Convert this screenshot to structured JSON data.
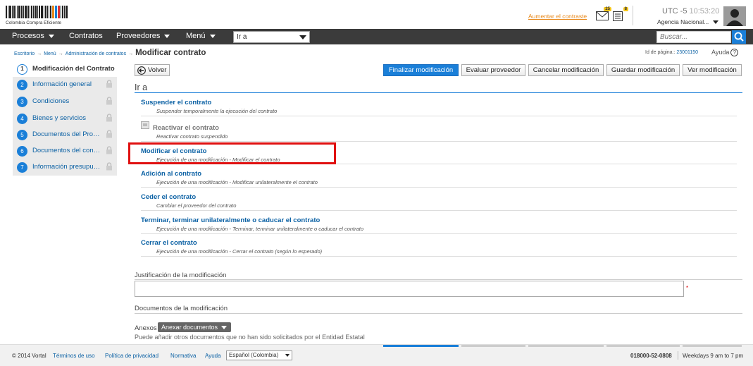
{
  "header": {
    "logo_text": "Colombia Compra Eficiente",
    "contrast_link": "Aumentar el contraste",
    "mail_badge": "25",
    "tasks_badge": "8",
    "utc_label": "UTC -5",
    "time": "10:53:20",
    "agency": "Agencia Nacional..."
  },
  "nav": {
    "items": [
      {
        "label": "Procesos",
        "dropdown": true
      },
      {
        "label": "Contratos",
        "dropdown": false
      },
      {
        "label": "Proveedores",
        "dropdown": true
      },
      {
        "label": "Menú",
        "dropdown": true
      }
    ],
    "goto_value": "Ir a",
    "search_placeholder": "Buscar..."
  },
  "breadcrumb": {
    "items": [
      "Escritorio",
      "Menú",
      "Administración de contratos"
    ],
    "current": "Modificar contrato",
    "page_id_label": "Id de página::",
    "page_id": "23001150",
    "help": "Ayuda",
    "help_symbol": "?"
  },
  "steps": [
    {
      "num": "1",
      "label": "Modificación del Contrato",
      "active": true
    },
    {
      "num": "2",
      "label": "Información general",
      "locked": true
    },
    {
      "num": "3",
      "label": "Condiciones",
      "locked": true
    },
    {
      "num": "4",
      "label": "Bienes y servicios",
      "locked": true
    },
    {
      "num": "5",
      "label": "Documentos del Proveedor",
      "locked": true
    },
    {
      "num": "6",
      "label": "Documentos del contrato",
      "locked": true
    },
    {
      "num": "7",
      "label": "Información presupuestal",
      "locked": true
    }
  ],
  "toolbar": {
    "back": "Volver",
    "finalize": "Finalizar modificación",
    "evaluate": "Evaluar proveedor",
    "cancel": "Cancelar modificación",
    "save": "Guardar modificación",
    "view": "Ver modificación"
  },
  "goto": {
    "title": "Ir a",
    "options": [
      {
        "title": "Suspender el contrato",
        "desc": "Suspender temporalmente la ejecución del contrato",
        "enabled": true
      },
      {
        "title": "Reactivar el contrato",
        "desc": "Reactivar contrato suspendido",
        "enabled": false
      },
      {
        "title": "Modificar el contrato",
        "desc": "Ejecución de una modificación - Modificar el contrato",
        "enabled": true,
        "highlighted": true
      },
      {
        "title": "Adición al contrato",
        "desc": "Ejecución de una modificación - Modificar unilateralmente el contrato",
        "enabled": true
      },
      {
        "title": "Ceder el contrato",
        "desc": "Cambiar el proveedor del contrato",
        "enabled": true
      },
      {
        "title": "Terminar, terminar unilateralmente o caducar el contrato",
        "desc": "Ejecución de una modificación - Terminar, terminar unilateralmente o caducar el contrato",
        "enabled": true
      },
      {
        "title": "Cerrar el contrato",
        "desc": "Ejecución de una modificación - Cerrar el contrato (según lo esperado)",
        "enabled": true
      }
    ]
  },
  "justification": {
    "label": "Justificación de la modificación",
    "value": "",
    "required_mark": "*"
  },
  "documents": {
    "label": "Documentos de la modificación",
    "annex_label": "Anexos",
    "annex_button": "Anexar documentos",
    "note": "Puede añadir otros documentos que no han sido solicitados por el Entidad Estatal"
  },
  "footer": {
    "copyright": "© 2014 Vortal",
    "links": [
      "Términos de uso",
      "Política de privacidad",
      "Normativa",
      "Ayuda"
    ],
    "language": "Español (Colombia)",
    "phone": "018000-52-0808",
    "hours": "Weekdays 9 am to 7 pm"
  },
  "colors": {
    "accent": "#1a7fd8",
    "navbar": "#3b3b3b",
    "link": "#0b61a4",
    "highlight": "#e01010",
    "contrast_link": "#e8891b"
  }
}
